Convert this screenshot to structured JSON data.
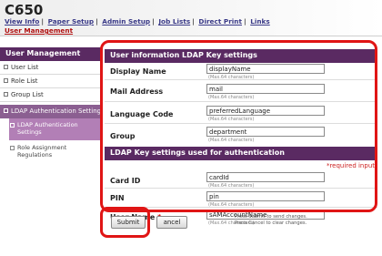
{
  "header": {
    "model": "C650",
    "nav": [
      "View Info",
      "Paper Setup",
      "Admin Setup",
      "Job Lists",
      "Direct Print",
      "Links"
    ],
    "subpage": "User Management"
  },
  "sidebar": {
    "title": "User Management",
    "items": [
      {
        "label": "User List"
      },
      {
        "label": "Role List"
      },
      {
        "label": "Group List"
      }
    ],
    "active": {
      "label": "LDAP Authentication Setting"
    },
    "subitems": [
      {
        "label": "LDAP Authentication Settings",
        "active": true
      },
      {
        "label": "Role Assignment Regulations",
        "active": false
      }
    ]
  },
  "section1": {
    "title": "User information LDAP Key settings",
    "fields": [
      {
        "label": "Display Name",
        "value": "displayName",
        "hint": "(Max.64 characters)",
        "required": false
      },
      {
        "label": "Mail Address",
        "value": "mail",
        "hint": "(Max.64 characters)",
        "required": false
      },
      {
        "label": "Language Code",
        "value": "preferredLanguage",
        "hint": "(Max.64 characters)",
        "required": false
      },
      {
        "label": "Group",
        "value": "department",
        "hint": "(Max.64 characters)",
        "required": false
      }
    ]
  },
  "section2": {
    "title": "LDAP Key settings used for authentication",
    "required_note": "*required input",
    "fields": [
      {
        "label": "Card ID",
        "value": "cardId",
        "hint": "(Max.64 characters)",
        "required": false
      },
      {
        "label": "PIN",
        "value": "pin",
        "hint": "(Max.64 characters)",
        "required": false
      },
      {
        "label": "User Name",
        "value": "sAMAccountName",
        "hint": "(Max.64 characters)",
        "required": true,
        "required_mark": "*"
      }
    ]
  },
  "actions": {
    "submit": "Submit",
    "cancel": "ancel",
    "help_lines": [
      "Press Submit to send changes.",
      "Press Cancel to clear changes."
    ]
  },
  "colors": {
    "accent": "#5a2a62",
    "active": "#8b5f91",
    "highlight": "#e01515"
  }
}
